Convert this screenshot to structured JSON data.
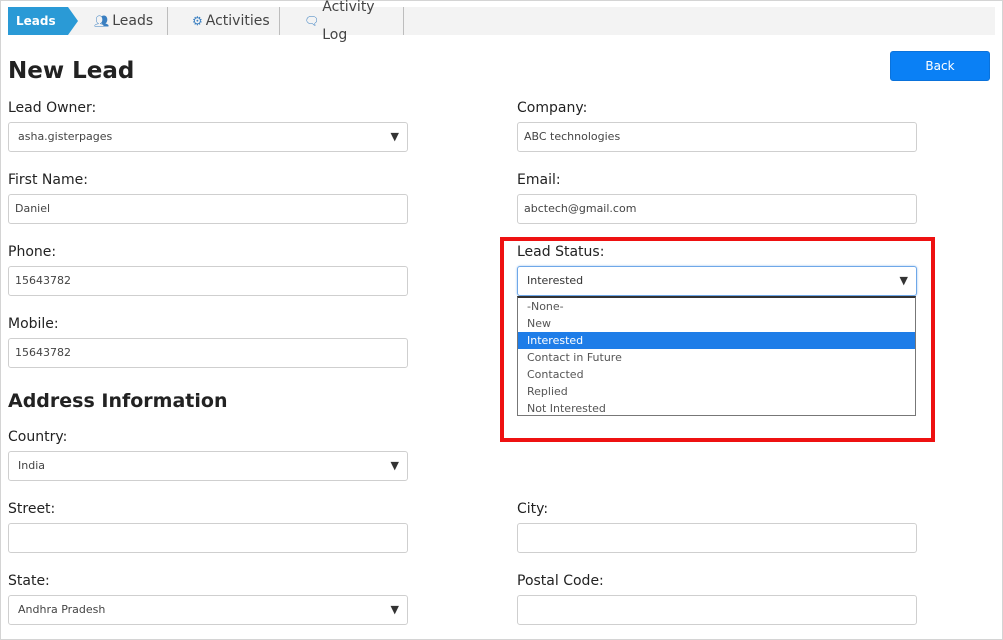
{
  "nav": {
    "badge": "Leads",
    "tabs": [
      {
        "label": "Leads",
        "icon": "users-icon"
      },
      {
        "label": "Activities",
        "icon": "gears-icon"
      },
      {
        "label": "Activity Log",
        "icon": "chat-bubbles-icon"
      }
    ]
  },
  "page": {
    "title": "New Lead",
    "back_label": "Back",
    "section_address": "Address Information"
  },
  "form": {
    "lead_owner": {
      "label": "Lead Owner:",
      "value": "asha.gisterpages"
    },
    "company": {
      "label": "Company:",
      "value": "ABC technologies"
    },
    "first_name": {
      "label": "First Name:",
      "value": "Daniel"
    },
    "email": {
      "label": "Email:",
      "value": "abctech@gmail.com"
    },
    "phone": {
      "label": "Phone:",
      "value": "15643782"
    },
    "lead_status": {
      "label": "Lead Status:",
      "value": "Interested",
      "options": [
        "-None-",
        "New",
        "Interested",
        "Contact in Future",
        "Contacted",
        "Replied",
        "Not Interested"
      ]
    },
    "mobile": {
      "label": "Mobile:",
      "value": "15643782"
    },
    "country": {
      "label": "Country:",
      "value": "India"
    },
    "street": {
      "label": "Street:",
      "value": ""
    },
    "city": {
      "label": "City:",
      "value": ""
    },
    "state": {
      "label": "State:",
      "value": "Andhra Pradesh"
    },
    "postal_code": {
      "label": "Postal Code:",
      "value": ""
    }
  },
  "colors": {
    "accent": "#2a9ad6",
    "button": "#0a80f5",
    "highlight": "#ee1111",
    "selected_option": "#1e7de8"
  }
}
